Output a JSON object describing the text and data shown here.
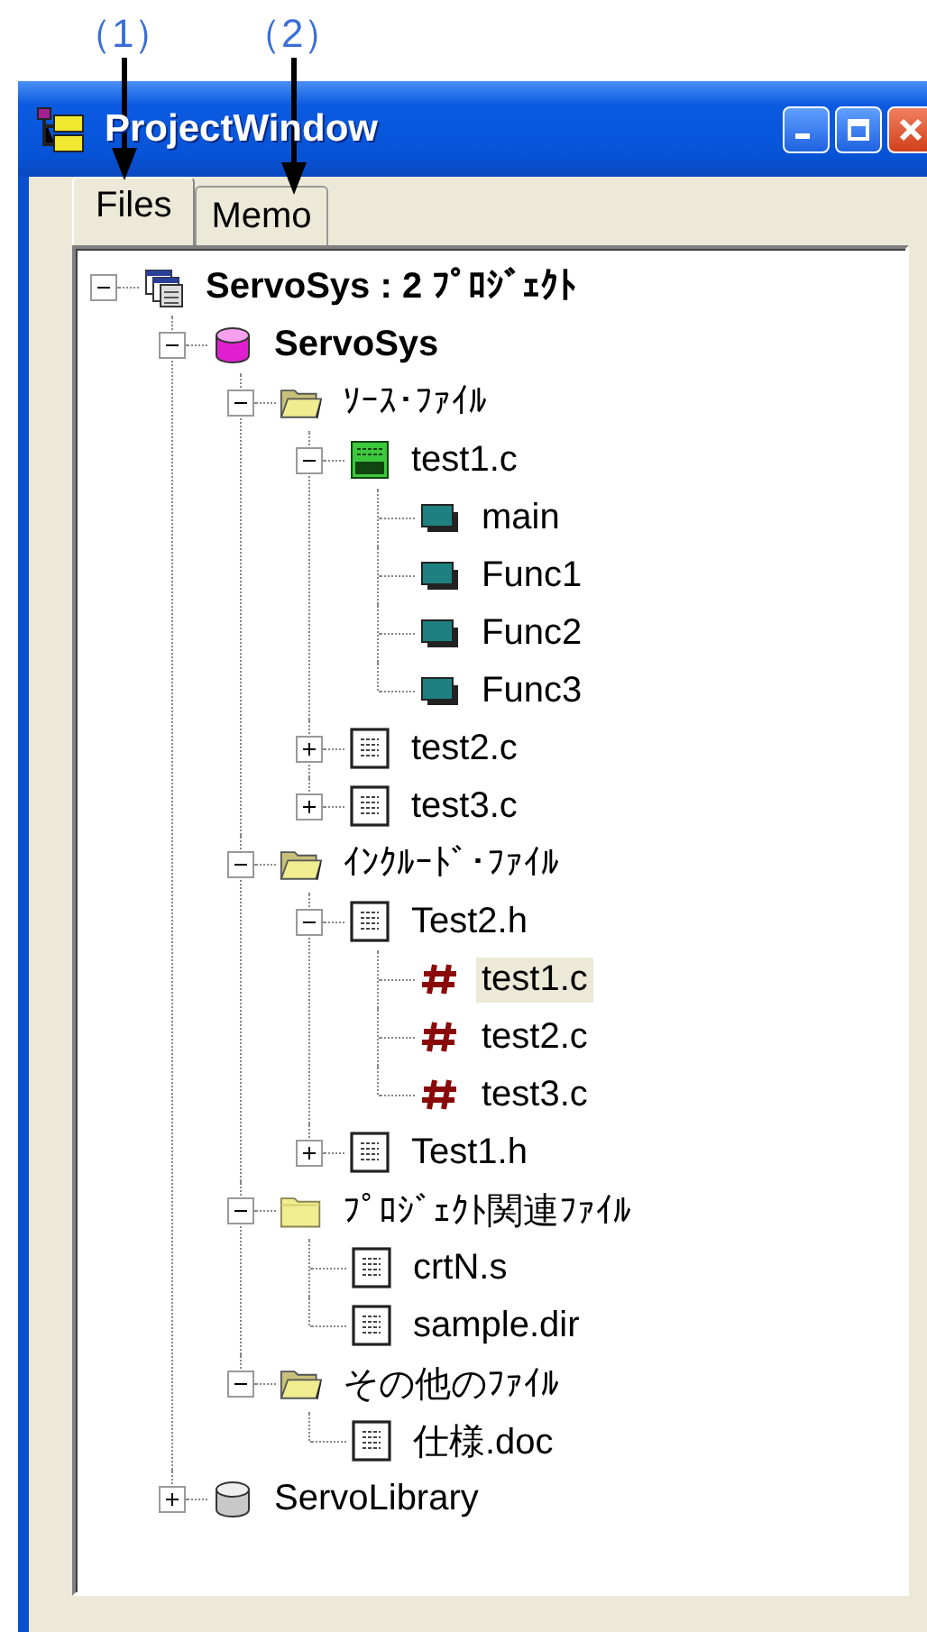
{
  "annotations": [
    {
      "label": "（1）"
    },
    {
      "label": "（2）"
    }
  ],
  "window": {
    "title": "ProjectWindow"
  },
  "tabs": [
    {
      "label": "Files",
      "selected": true
    },
    {
      "label": "Memo",
      "selected": false
    }
  ],
  "tree": [
    {
      "label": "ServoSys : 2 ﾌﾟﾛｼﾞｪｸﾄ",
      "kind": "workspace",
      "expanded": true,
      "selected": false,
      "children": [
        {
          "label": "ServoSys",
          "kind": "project",
          "expanded": true,
          "selected": false,
          "children": [
            {
              "label": "ｿｰｽ･ﾌｧｲﾙ",
              "kind": "openfolder",
              "expanded": true,
              "selected": false,
              "children": [
                {
                  "label": "test1.c",
                  "kind": "source",
                  "expanded": true,
                  "selected": false,
                  "children": [
                    {
                      "label": "main",
                      "kind": "function",
                      "selected": false
                    },
                    {
                      "label": "Func1",
                      "kind": "function",
                      "selected": false
                    },
                    {
                      "label": "Func2",
                      "kind": "function",
                      "selected": false
                    },
                    {
                      "label": "Func3",
                      "kind": "function",
                      "selected": false
                    }
                  ]
                },
                {
                  "label": "test2.c",
                  "kind": "file",
                  "expanded": false,
                  "selected": false
                },
                {
                  "label": "test3.c",
                  "kind": "file",
                  "expanded": false,
                  "selected": false
                }
              ]
            },
            {
              "label": "ｲﾝｸﾙｰﾄﾞ･ﾌｧｲﾙ",
              "kind": "openfolder",
              "expanded": true,
              "selected": false,
              "children": [
                {
                  "label": "Test2.h",
                  "kind": "file",
                  "expanded": true,
                  "selected": false,
                  "children": [
                    {
                      "label": "test1.c",
                      "kind": "include",
                      "selected": true
                    },
                    {
                      "label": "test2.c",
                      "kind": "include",
                      "selected": false
                    },
                    {
                      "label": "test3.c",
                      "kind": "include",
                      "selected": false
                    }
                  ]
                },
                {
                  "label": "Test1.h",
                  "kind": "file",
                  "expanded": false,
                  "selected": false
                }
              ]
            },
            {
              "label": "ﾌﾟﾛｼﾞｪｸﾄ関連ﾌｧｲﾙ",
              "kind": "folder",
              "expanded": true,
              "selected": false,
              "children": [
                {
                  "label": "crtN.s",
                  "kind": "file",
                  "selected": false
                },
                {
                  "label": "sample.dir",
                  "kind": "file",
                  "selected": false
                }
              ]
            },
            {
              "label": "その他のﾌｧｲﾙ",
              "kind": "openfolder",
              "expanded": true,
              "selected": false,
              "children": [
                {
                  "label": "仕様.doc",
                  "kind": "file",
                  "selected": false
                }
              ]
            }
          ]
        },
        {
          "label": "ServoLibrary",
          "kind": "library",
          "expanded": false,
          "selected": false
        }
      ]
    }
  ]
}
